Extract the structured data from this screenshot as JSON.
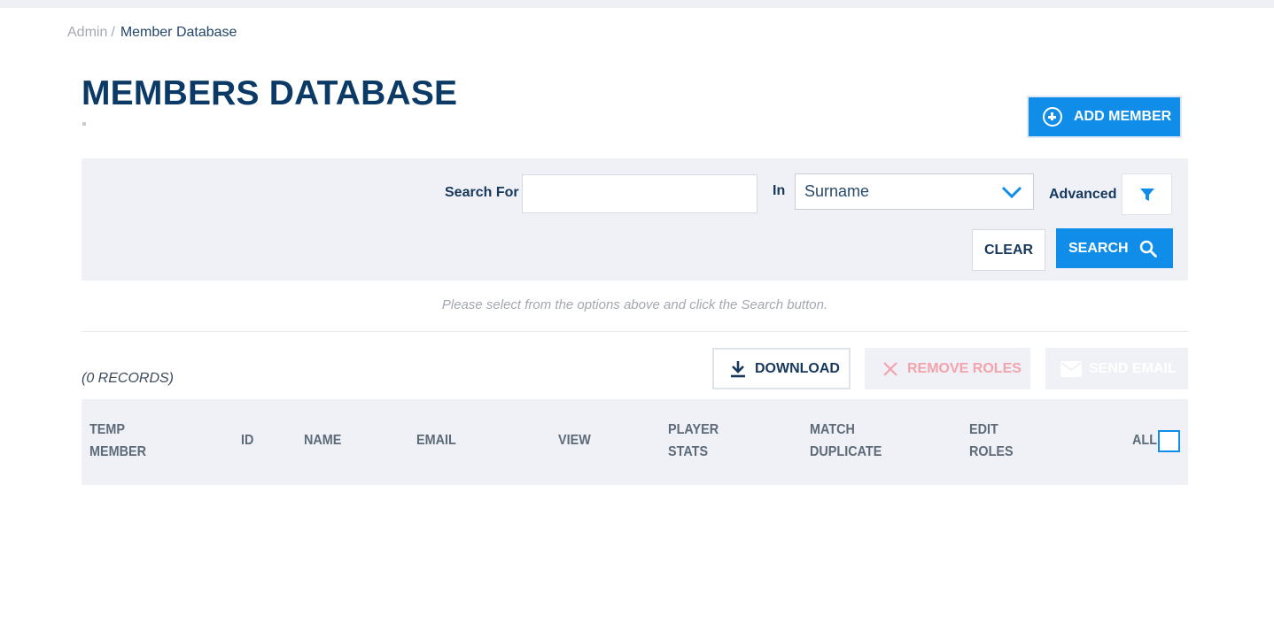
{
  "breadcrumb": {
    "parent": "Admin",
    "separator": "/",
    "current": "Member Database"
  },
  "page": {
    "title": "MEMBERS DATABASE"
  },
  "actions": {
    "add_member_label": "ADD MEMBER"
  },
  "search": {
    "search_for_label": "Search For",
    "search_value": "",
    "in_label": "In",
    "in_selected": "Surname",
    "advanced_label": "Advanced",
    "clear_label": "CLEAR",
    "search_label": "SEARCH"
  },
  "hint": "Please select from the options above and click the Search button.",
  "results": {
    "records": "(0 RECORDS)",
    "download_label": "DOWNLOAD",
    "remove_roles_label": "REMOVE ROLES",
    "send_email_label": "SEND EMAIL"
  },
  "table": {
    "columns": {
      "temp_member": [
        "TEMP",
        "MEMBER"
      ],
      "id": "ID",
      "name": "NAME",
      "email": "EMAIL",
      "view": "VIEW",
      "player_stats": [
        "PLAYER",
        "STATS"
      ],
      "match_duplicate": [
        "MATCH",
        "DUPLICATE"
      ],
      "edit_roles": [
        "EDIT",
        "ROLES"
      ],
      "all": "ALL"
    },
    "select_all_checked": false
  },
  "colors": {
    "primary": "#108de8",
    "title": "#0c3a66",
    "panel": "#eff1f6",
    "danger_muted": "#f2a3ab"
  },
  "icons": {
    "add": "plus-circle-icon",
    "dropdown": "chevron-down-icon",
    "filter": "filter-icon",
    "search": "search-icon",
    "download": "download-icon",
    "remove": "close-icon",
    "email": "mail-icon"
  }
}
